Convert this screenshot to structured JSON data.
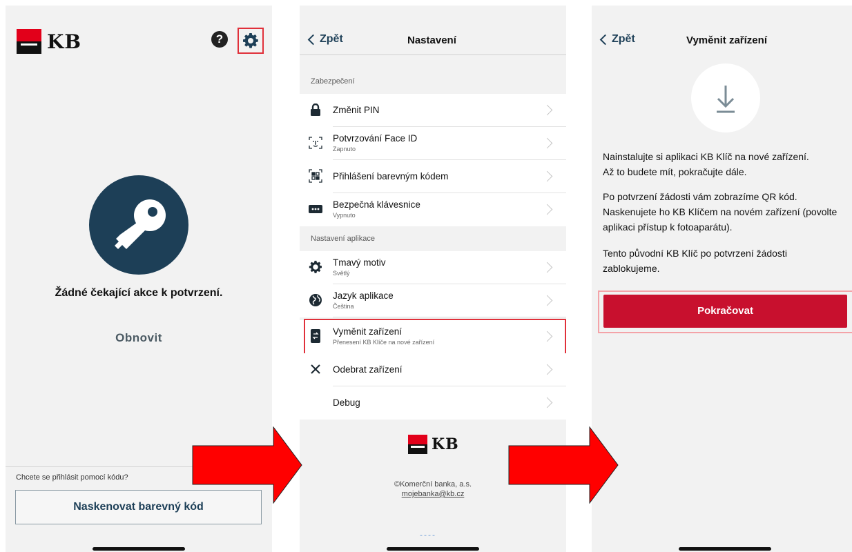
{
  "colors": {
    "kb_red": "#e2001a",
    "button_red": "#c8102e",
    "navy": "#1d3f57",
    "highlight": "#e0303a",
    "arrow_red": "#ff0000"
  },
  "screen1": {
    "logo_text": "KB",
    "help_icon": "question-circle-icon",
    "settings_icon": "gear-icon",
    "center_icon": "key-icon",
    "message": "Žádné čekající akce k potvrzení.",
    "refresh_label": "Obnovit",
    "prompt": "Chcete se přihlásit pomocí kódu?",
    "scan_button": "Naskenovat barevný kód"
  },
  "screen2": {
    "back_label": "Zpět",
    "title": "Nastavení",
    "sections": [
      {
        "header": "Zabezpečení",
        "items": [
          {
            "label": "Změnit PIN",
            "sub": "",
            "icon": "lock-icon"
          },
          {
            "label": "Potvrzování Face ID",
            "sub": "Zapnuto",
            "icon": "face-id-icon"
          },
          {
            "label": "Přihlášení barevným kódem",
            "sub": "",
            "icon": "qr-code-icon"
          },
          {
            "label": "Bezpečná klávesnice",
            "sub": "Vypnuto",
            "icon": "keyboard-icon"
          }
        ]
      },
      {
        "header": "Nastavení aplikace",
        "items": [
          {
            "label": "Tmavý motiv",
            "sub": "Světlý",
            "icon": "gear-icon"
          },
          {
            "label": "Jazyk aplikace",
            "sub": "Čeština",
            "icon": "globe-icon"
          },
          {
            "label": "Vyměnit zařízení",
            "sub": "Přenesení KB Klíče na nové zařízení",
            "icon": "phone-swap-icon"
          },
          {
            "label": "Odebrat zařízení",
            "sub": "",
            "icon": "close-icon"
          },
          {
            "label": "Debug",
            "sub": "",
            "icon": ""
          }
        ]
      }
    ],
    "footer_logo_text": "KB",
    "copyright": "©Komerční banka, a.s.",
    "email": "mojebanka@kb.cz",
    "dashes": "----"
  },
  "screen3": {
    "back_label": "Zpět",
    "title": "Vyměnit zařízení",
    "icon": "download-icon",
    "para1_line1": "Nainstalujte si aplikaci KB Klíč na nové zařízení.",
    "para1_line2": "Až to budete mít, pokračujte dále.",
    "para2_line1": "Po potvrzení žádosti vám zobrazíme QR kód.",
    "para2_line2": "Naskenujete ho KB Klíčem na novém zařízení (povolte",
    "para2_line3": "aplikaci přístup k fotoaparátu).",
    "para3_line1": "Tento původní KB Klíč po potvrzení žádosti",
    "para3_line2": "zablokujeme.",
    "continue_button": "Pokračovat"
  }
}
